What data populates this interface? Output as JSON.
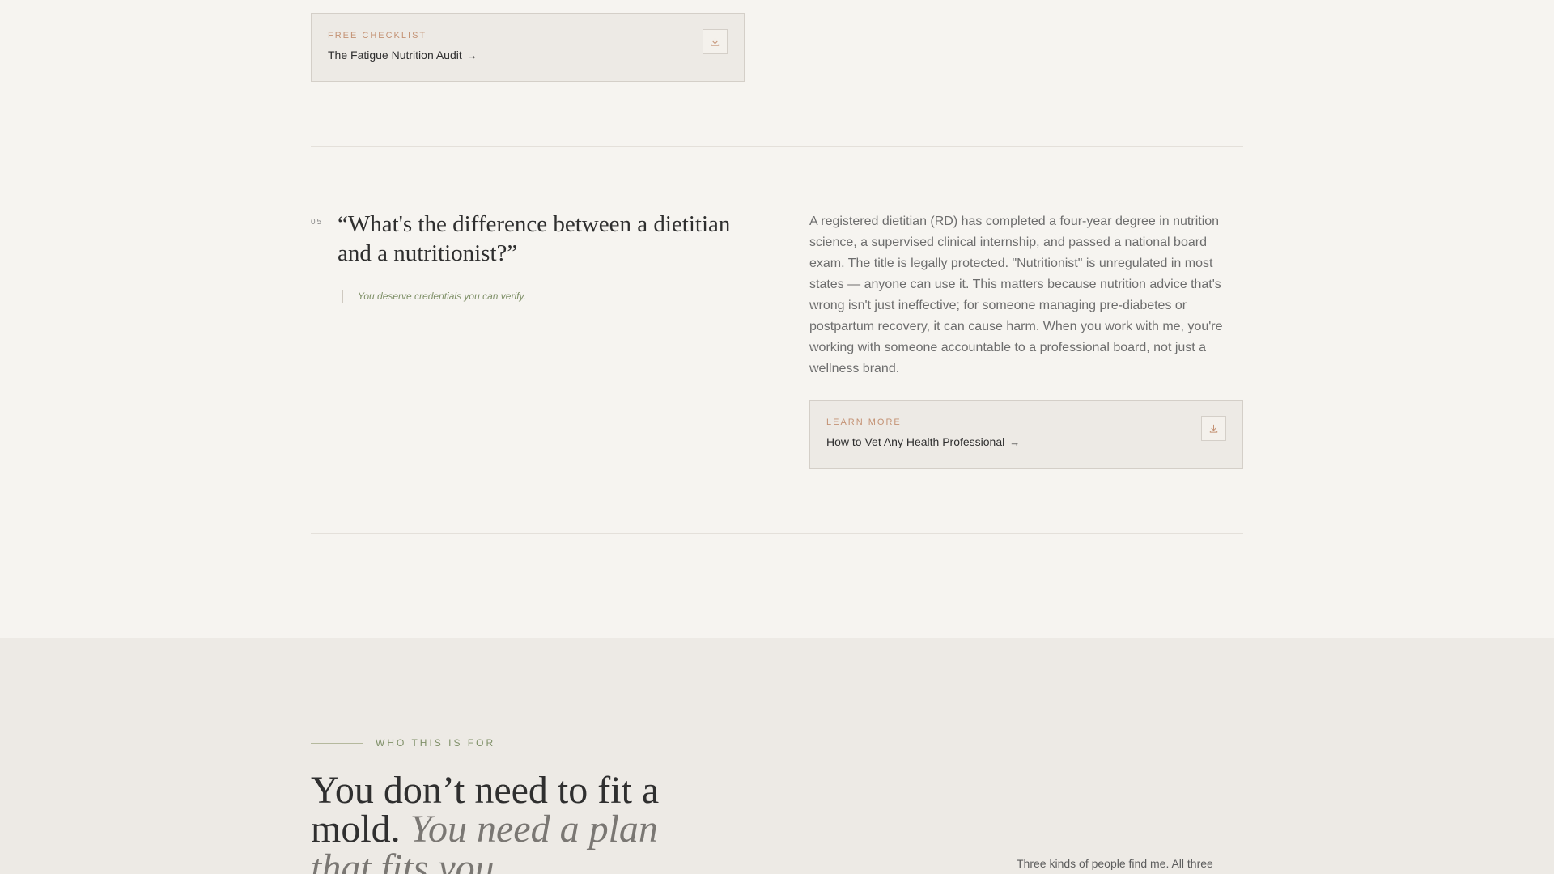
{
  "resources": {
    "checklist": {
      "label": "FREE CHECKLIST",
      "title": "The Fatigue Nutrition Audit",
      "arrow": "→",
      "icon": "download-icon"
    },
    "learn_more": {
      "label": "LEARN MORE",
      "title": "How to Vet Any Health Professional",
      "arrow": "→",
      "icon": "download-icon"
    }
  },
  "faq": {
    "number": "05",
    "question": "“What's the difference between a dietitian and a nutritionist?”",
    "pull_quote": "You deserve credentials you can verify.",
    "answer": "A registered dietitian (RD) has completed a four-year degree in nutrition science, a supervised clinical internship, and passed a national board exam. The title is legally protected. \"Nutritionist\" is unregulated in most states — anyone can use it. This matters because nutrition advice that's wrong isn't just ineffective; for someone managing pre-diabetes or postpartum recovery, it can cause harm. When you work with me, you're working with someone accountable to a professional board, not just a wellness brand."
  },
  "who_section": {
    "eyebrow": "WHO THIS IS FOR",
    "heading_plain": "You don’t need to fit a mold.",
    "heading_italic": "You need a plan that fits you.",
    "intro": "Three kinds of people find me. All three"
  },
  "colors": {
    "page_bg": "#f6f4f0",
    "section_bg": "#edeae5",
    "accent_terracotta": "#c49274",
    "accent_sage": "#7f9068",
    "text_dark": "#2f2f2f",
    "text_body": "#6d6d6d"
  }
}
